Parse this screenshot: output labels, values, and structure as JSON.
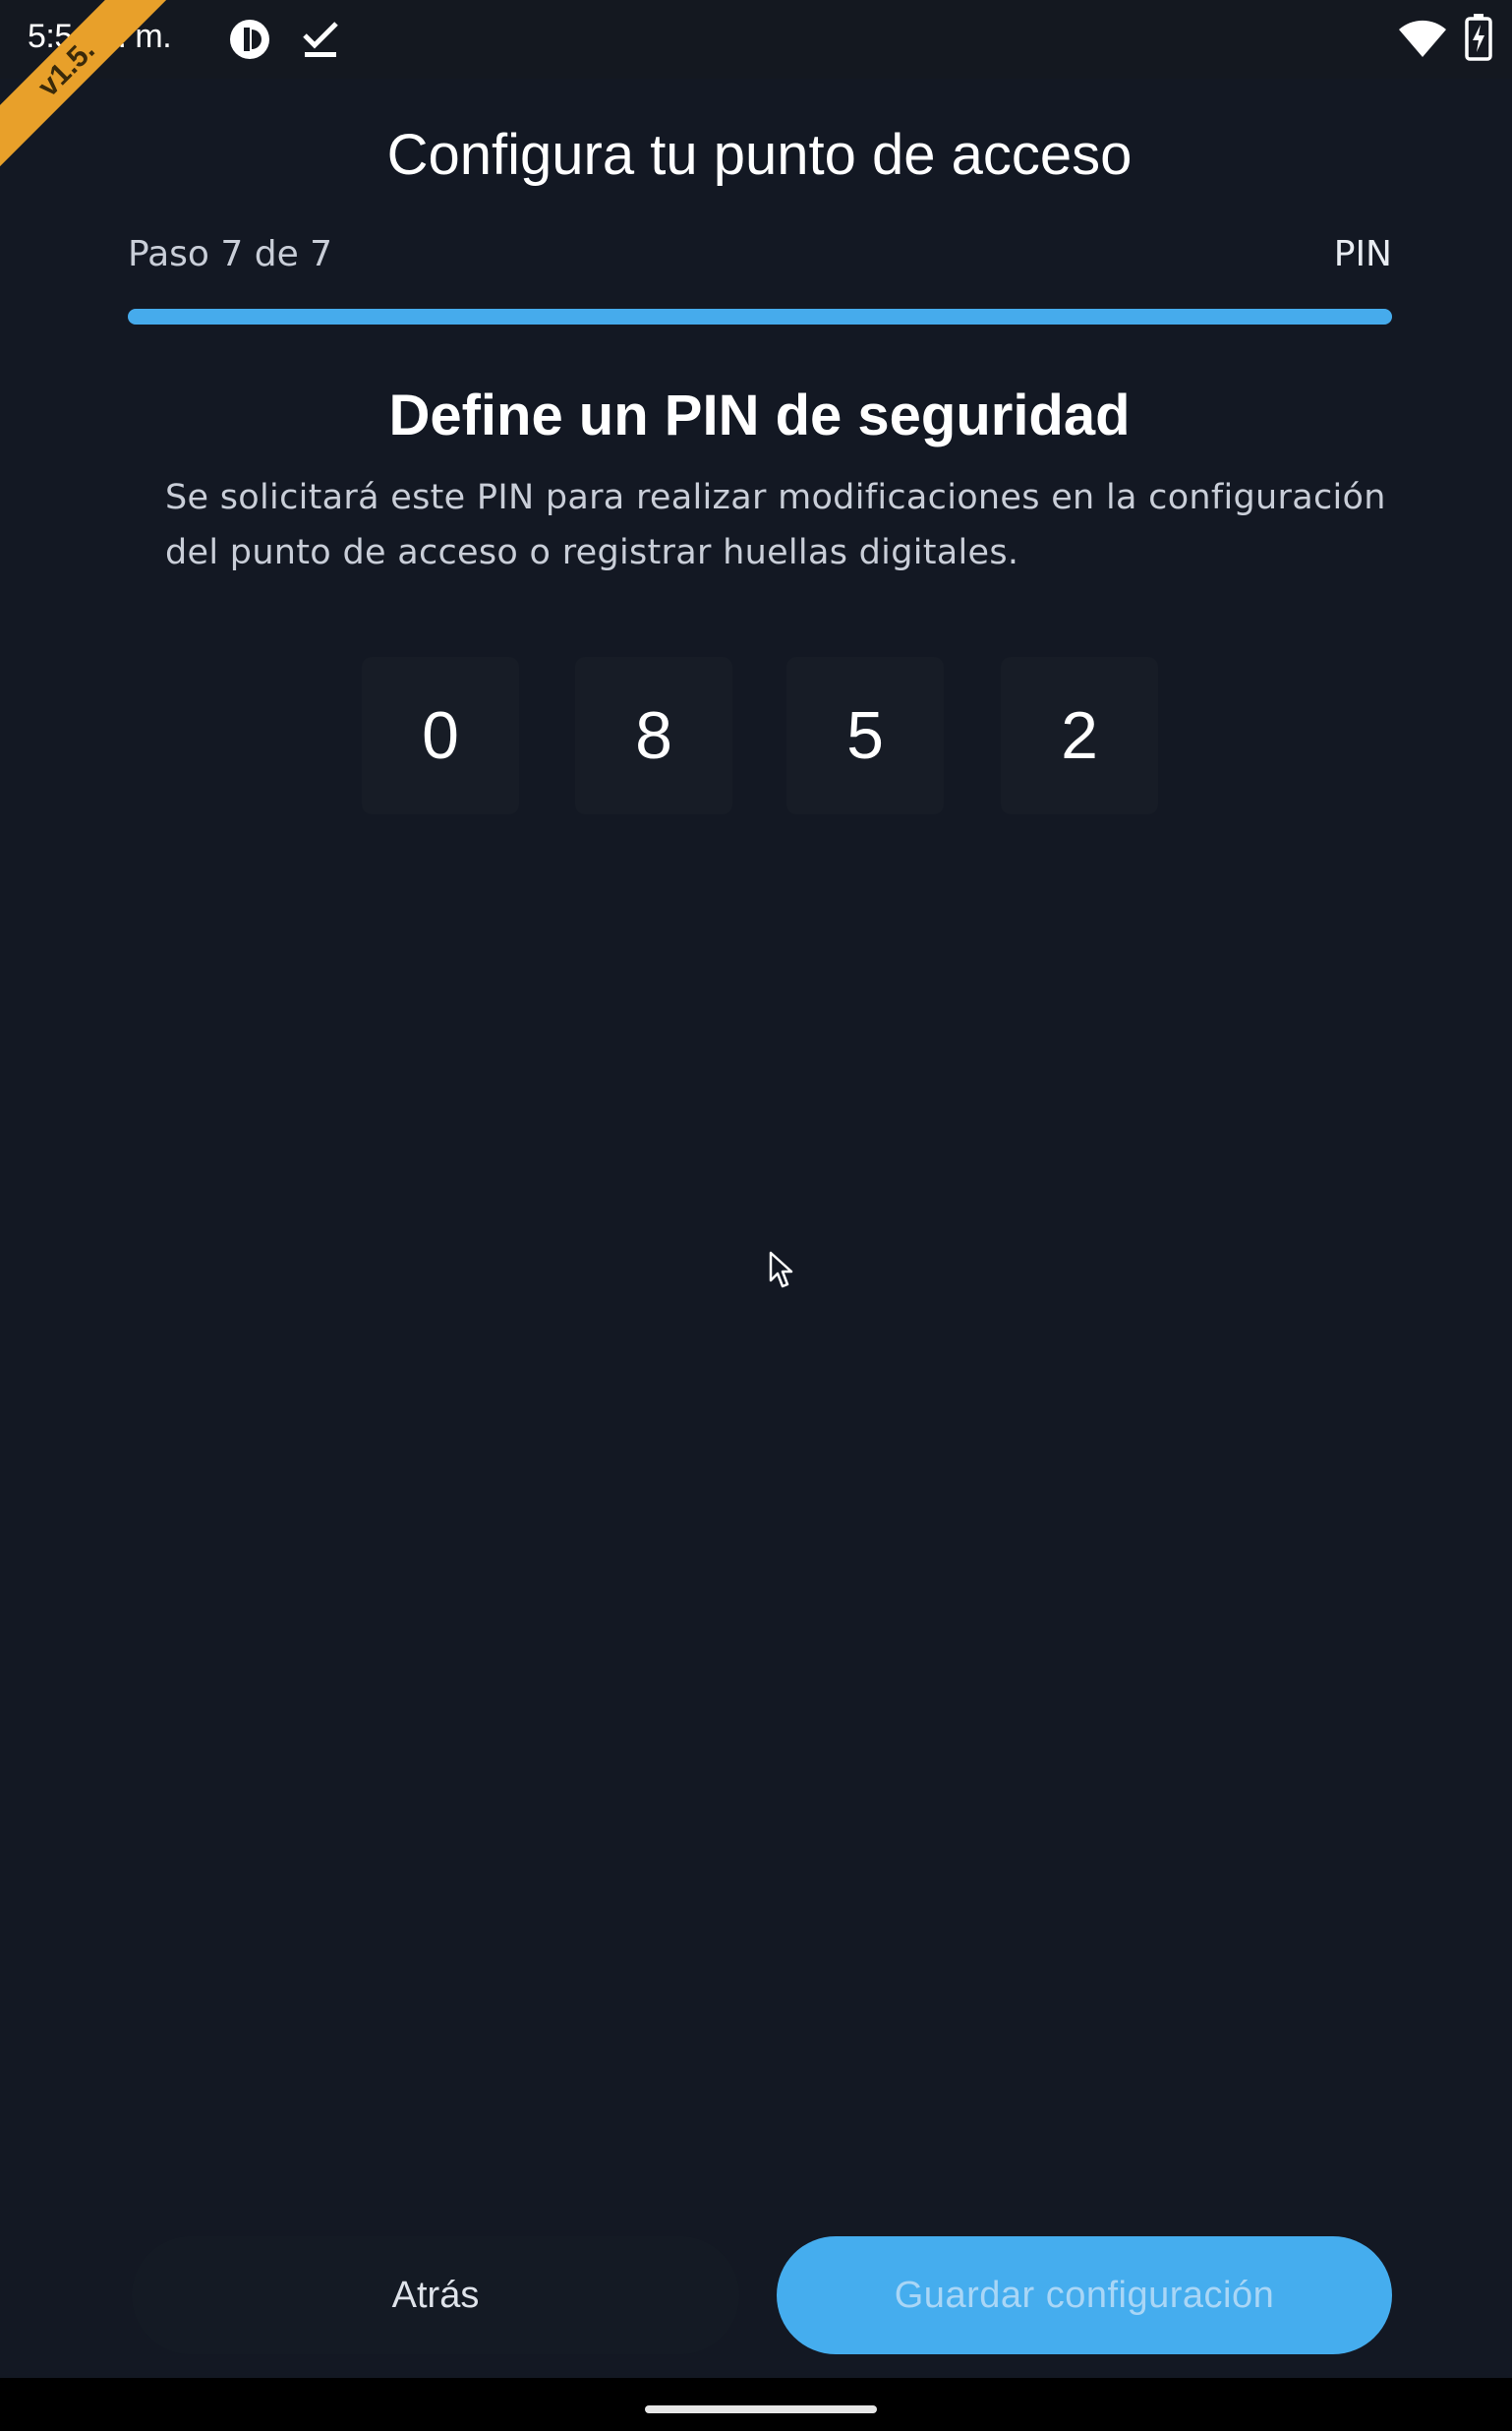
{
  "status_bar": {
    "time": "5:54 a. m.",
    "icons": [
      "app-notification-icon",
      "checkmark-icon",
      "wifi-icon",
      "battery-charging-icon"
    ]
  },
  "debug_banner": "v1.5.",
  "header": {
    "title": "Configura tu punto de acceso",
    "step_label": "Paso 7 de 7",
    "step_name": "PIN",
    "progress": 1.0
  },
  "content": {
    "title": "Define un PIN de seguridad",
    "description": "Se solicitará este PIN para realizar modificaciones en la configuración del punto de acceso o registrar huellas digitales.",
    "pin_digits": [
      "0",
      "8",
      "5",
      "2"
    ]
  },
  "footer": {
    "back_label": "Atrás",
    "save_label": "Guardar configuración"
  },
  "colors": {
    "background": "#131823",
    "accent": "#46abec",
    "banner": "#e8a02a"
  }
}
